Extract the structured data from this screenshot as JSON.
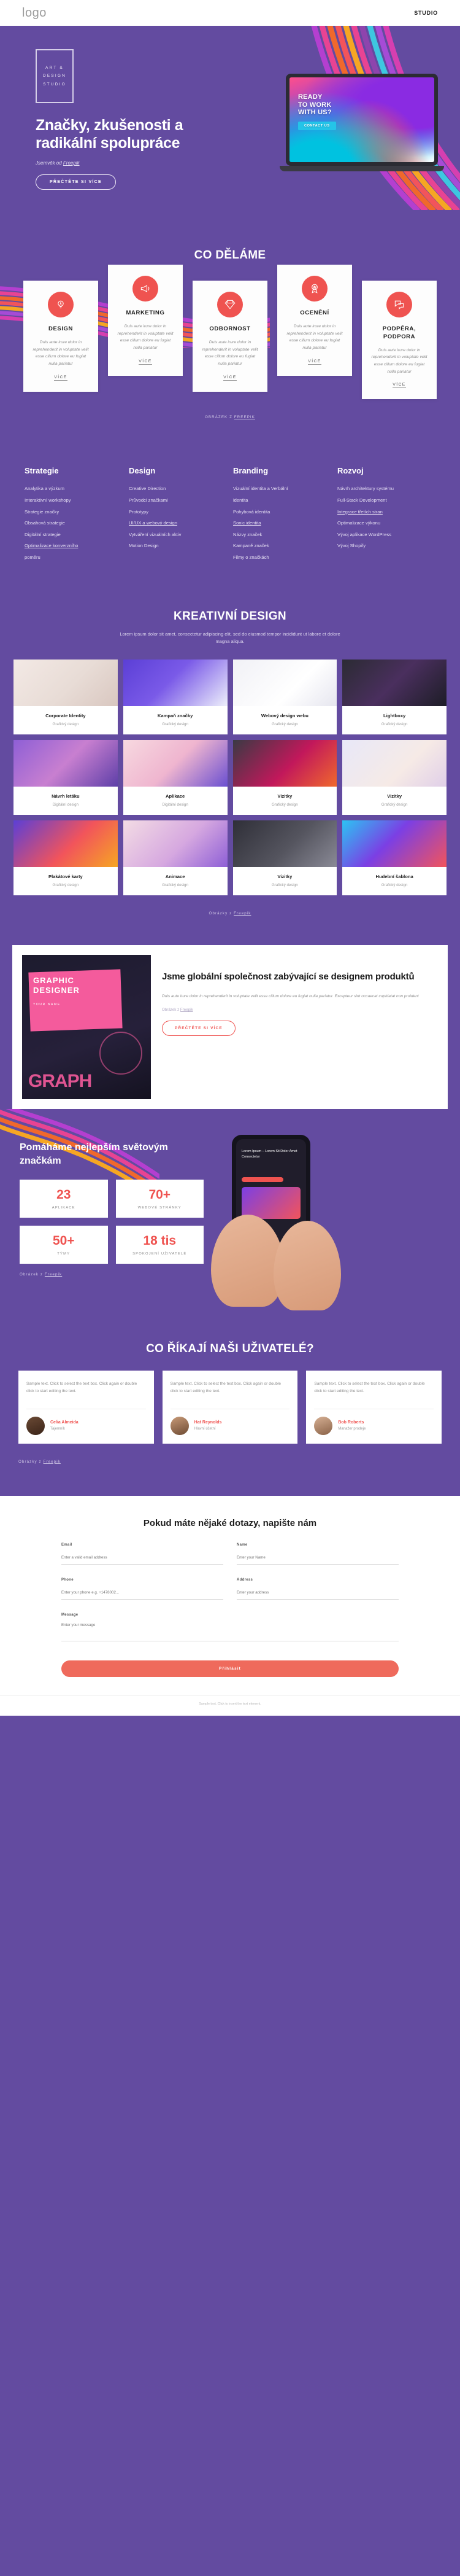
{
  "topbar": {
    "logo": "logo",
    "nav_studio": "STUDIO"
  },
  "hero": {
    "logo_line1": "ART &",
    "logo_line2": "DESIGN",
    "logo_line3": "STUDIO",
    "headline": "Značky, zkušenosti a radikální spolupráce",
    "credit_prefix": "Jsemvěk od ",
    "credit_link": "Freepik",
    "cta": "PŘEČTĚTE SI VÍCE",
    "laptop_line1": "READY",
    "laptop_line2": "TO WORK",
    "laptop_line3": "WITH US?",
    "laptop_btn": "CONTACT US"
  },
  "what_we_do": {
    "title": "CO DĚLÁME",
    "body": "Duis aute irure dolor in reprehenderit in voluptate velit esse cillum dolore eu fugiat nulla pariatur",
    "more": "VÍCE",
    "credit_prefix": "OBRÁZEK Z ",
    "credit_link": "FREEPIK",
    "cards": [
      {
        "title": "DESIGN",
        "icon": "lightbulb-icon"
      },
      {
        "title": "MARKETING",
        "icon": "megaphone-icon"
      },
      {
        "title": "ODBORNOST",
        "icon": "diamond-icon"
      },
      {
        "title": "OCENĚNÍ",
        "icon": "award-icon"
      },
      {
        "title": "PODPĚRA, PODPORA",
        "icon": "chat-icon"
      }
    ]
  },
  "services": [
    {
      "heading": "Strategie",
      "items": [
        {
          "label": "Analytika a výzkum",
          "underline": false
        },
        {
          "label": "Interaktivní workshopy",
          "underline": false
        },
        {
          "label": "Strategie značky",
          "underline": false
        },
        {
          "label": "Obsahová strategie",
          "underline": false
        },
        {
          "label": "Digitální strategie",
          "underline": false
        },
        {
          "label": "Optimalizace konverzního",
          "underline": true
        },
        {
          "label": "poměru",
          "underline": false
        }
      ]
    },
    {
      "heading": "Design",
      "items": [
        {
          "label": "Creative Direction",
          "underline": false
        },
        {
          "label": "Průvodci značkami",
          "underline": false
        },
        {
          "label": "Prototypy",
          "underline": false
        },
        {
          "label": "UI/UX a webový design",
          "underline": true
        },
        {
          "label": "Vytváření vizuálních aktiv",
          "underline": false
        },
        {
          "label": "Motion Design",
          "underline": false
        }
      ]
    },
    {
      "heading": "Branding",
      "items": [
        {
          "label": "Vizuální identita a Verbální",
          "underline": false
        },
        {
          "label": "identita",
          "underline": false
        },
        {
          "label": "Pohybová identita",
          "underline": false
        },
        {
          "label": "Sonic identita",
          "underline": true
        },
        {
          "label": "Názvy značek",
          "underline": false
        },
        {
          "label": "Kampaně značek",
          "underline": false
        },
        {
          "label": "Filmy o značkách",
          "underline": false
        }
      ]
    },
    {
      "heading": "Rozvoj",
      "items": [
        {
          "label": "Návrh architektury systému",
          "underline": false
        },
        {
          "label": "Full-Stack Development",
          "underline": false
        },
        {
          "label": "Integrace třetích stran",
          "underline": true
        },
        {
          "label": "Optimalizace výkonu",
          "underline": false
        },
        {
          "label": "Vývoj aplikace WordPress",
          "underline": false
        },
        {
          "label": "Vývoj Shopify",
          "underline": false
        }
      ]
    }
  ],
  "creative": {
    "title": "KREATIVNÍ DESIGN",
    "subtitle": "Lorem ipsum dolor sit amet, consectetur adipiscing elit, sed do eiusmod tempor incididunt ut labore et dolore magna aliqua.",
    "credit_prefix": "Obrázky z ",
    "credit_link": "Freepik",
    "caption_sub": "Grafický design",
    "tiles": [
      {
        "title": "Corporate Identity",
        "sub": "Grafický design"
      },
      {
        "title": "Kampaň značky",
        "sub": "Grafický design"
      },
      {
        "title": "Webový design webu",
        "sub": "Grafický design"
      },
      {
        "title": "Lightboxy",
        "sub": "Grafický design"
      },
      {
        "title": "Návrh letáku",
        "sub": "Digitální design"
      },
      {
        "title": "Aplikace",
        "sub": "Digitální design"
      },
      {
        "title": "Vizitky",
        "sub": "Grafický design"
      },
      {
        "title": "Vizitky",
        "sub": "Grafický design"
      },
      {
        "title": "Plakátové karty",
        "sub": "Grafický design"
      },
      {
        "title": "Animace",
        "sub": "Grafický design"
      },
      {
        "title": "Vizitky",
        "sub": "Grafický design"
      },
      {
        "title": "Hudební šablona",
        "sub": "Grafický design"
      }
    ]
  },
  "global": {
    "poster_l1": "GRAPHIC",
    "poster_l2": "DESIGNER",
    "poster_sub": "YOUR NAME",
    "poster_big": "GRAPH",
    "heading": "Jsme globální společnost zabývající se designem produktů",
    "body": "Duis aute irure dolor in reprehenderit in voluptate velit esse cillum dolore eu fugiat nulla pariatur. Excepteur sint occaecat cupidatat non proident",
    "credit_prefix": "Obrázek z ",
    "credit_link": "Freepik",
    "cta": "PŘEČTĚTE SI VÍCE"
  },
  "stats": {
    "heading": "Pomáháme nejlepším světovým značkám",
    "credit_prefix": "Obrázek z ",
    "credit_link": "Freepik",
    "boxes": [
      {
        "num": "23",
        "label": "APLIKACE"
      },
      {
        "num": "70+",
        "label": "WEBOVÉ STRÁNKY"
      },
      {
        "num": "50+",
        "label": "TÝMY"
      },
      {
        "num": "18 tis",
        "label": "SPOKOJENÍ UŽIVATELÉ"
      }
    ],
    "phone_text": "Lorem Ipsum – Lorem Sit Dolor Amet Consectetur"
  },
  "testimonials": {
    "title": "CO ŘÍKAJÍ NAŠI UŽIVATELÉ?",
    "credit_prefix": "Obrázky z ",
    "credit_link": "Freepik",
    "items": [
      {
        "text": "Sample text. Click to select the text box. Click again or double click to start editing the text.",
        "name": "Celia Almeida",
        "role": "Tajemník"
      },
      {
        "text": "Sample text. Click to select the text box. Click again or double click to start editing the text.",
        "name": "Hat Reynolds",
        "role": "Hlavní účetní"
      },
      {
        "text": "Sample text. Click to select the text box. Click again or double click to start editing the text.",
        "name": "Bob Roberts",
        "role": "Manažer prodeje"
      }
    ]
  },
  "contact": {
    "heading": "Pokud máte nějaké dotazy, napište nám",
    "fields": [
      {
        "label": "Email",
        "placeholder": "Enter a valid email address"
      },
      {
        "label": "Name",
        "placeholder": "Enter your Name"
      },
      {
        "label": "Phone",
        "placeholder": "Enter your phone e.g. +1478002..."
      },
      {
        "label": "Address",
        "placeholder": "Enter your address"
      }
    ],
    "message_label": "Message",
    "message_placeholder": "Enter your message",
    "submit": "Přihlásit"
  },
  "footer": {
    "text": "Sample text. Click to insert the text element."
  },
  "colors": {
    "purple": "#634ba0",
    "red": "#ef5350",
    "white": "#ffffff"
  }
}
